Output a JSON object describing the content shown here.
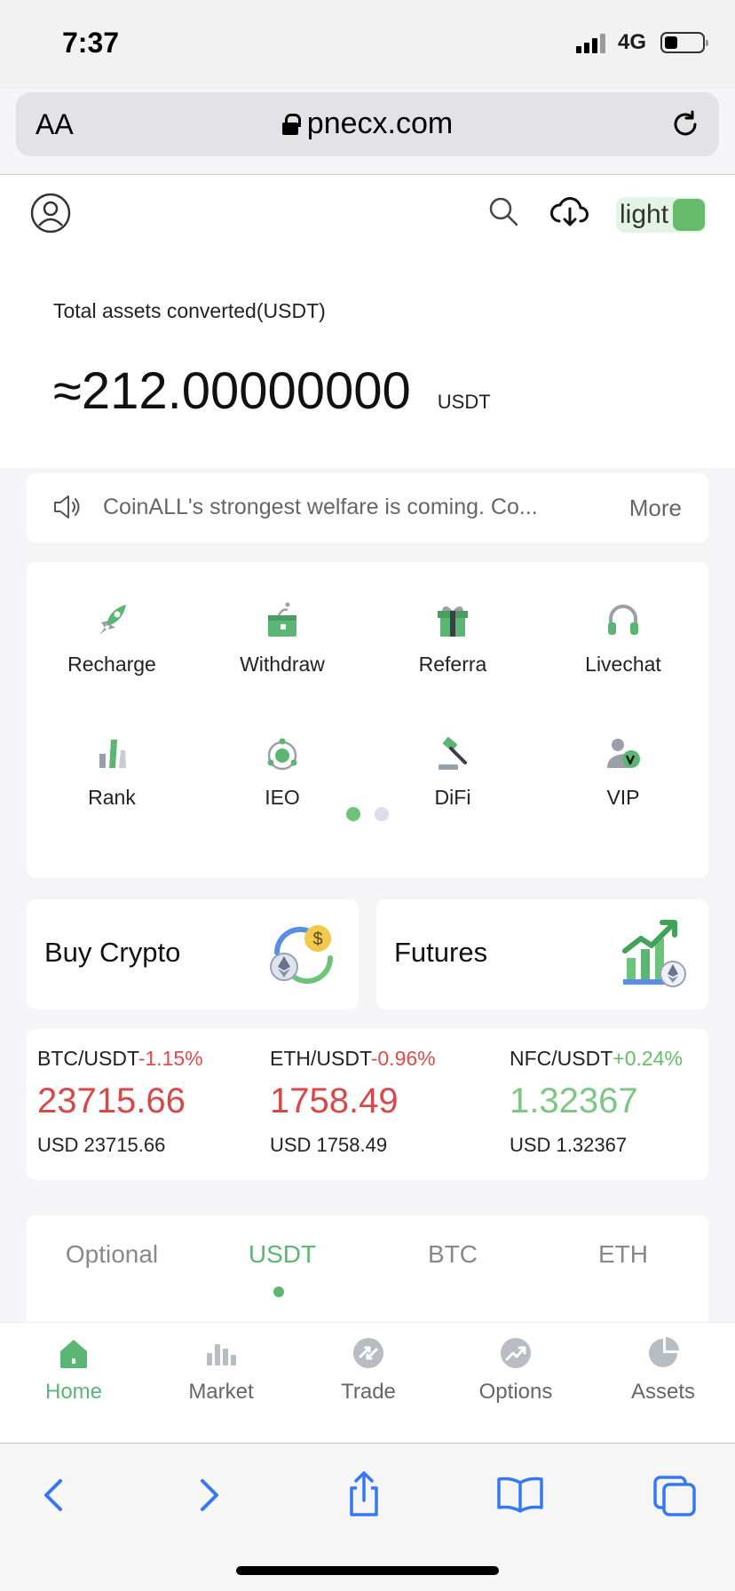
{
  "status_bar": {
    "time": "7:37",
    "network": "4G"
  },
  "browser": {
    "text_size_label": "AA",
    "url": "pnecx.com"
  },
  "header": {
    "theme_label": "light"
  },
  "assets": {
    "label": "Total assets converted(USDT)",
    "value": "≈212.00000000",
    "unit": "USDT"
  },
  "notice": {
    "text": "CoinALL's strongest welfare is coming. Co...",
    "more_label": "More"
  },
  "menu": {
    "items": [
      {
        "label": "Recharge",
        "icon": "rocket-icon"
      },
      {
        "label": "Withdraw",
        "icon": "wallet-icon"
      },
      {
        "label": "Referra",
        "icon": "gift-icon"
      },
      {
        "label": "Livechat",
        "icon": "headset-icon"
      },
      {
        "label": "Rank",
        "icon": "rank-bars-icon"
      },
      {
        "label": "IEO",
        "icon": "ieo-orbit-icon"
      },
      {
        "label": "DiFi",
        "icon": "gavel-icon"
      },
      {
        "label": "VIP",
        "icon": "vip-user-icon"
      }
    ],
    "pages": 2,
    "active_page": 1
  },
  "promos": {
    "buy_crypto": {
      "label": "Buy Crypto",
      "icon": "crypto-exchange-icon"
    },
    "futures": {
      "label": "Futures",
      "icon": "futures-chart-icon"
    }
  },
  "tickers": [
    {
      "pair": "BTC/USDT",
      "change": "-1.15%",
      "price": "23715.66",
      "usd": "USD 23715.66",
      "direction": "down"
    },
    {
      "pair": "ETH/USDT",
      "change": "-0.96%",
      "price": "1758.49",
      "usd": "USD 1758.49",
      "direction": "down"
    },
    {
      "pair": "NFC/USDT",
      "change": "+0.24%",
      "price": "1.32367",
      "usd": "USD 1.32367",
      "direction": "up"
    }
  ],
  "market_tabs": {
    "tabs": [
      "Optional",
      "USDT",
      "BTC",
      "ETH"
    ],
    "active": "USDT"
  },
  "bottom_nav": {
    "items": [
      {
        "label": "Home",
        "icon": "home-icon"
      },
      {
        "label": "Market",
        "icon": "market-bars-icon"
      },
      {
        "label": "Trade",
        "icon": "trade-icon"
      },
      {
        "label": "Options",
        "icon": "options-trend-icon"
      },
      {
        "label": "Assets",
        "icon": "pie-chart-icon"
      }
    ],
    "active": "Home"
  },
  "colors": {
    "accent_green": "#5bb673",
    "down_red": "#d84848",
    "up_green": "#7ec684",
    "ios_blue": "#3478f6"
  }
}
